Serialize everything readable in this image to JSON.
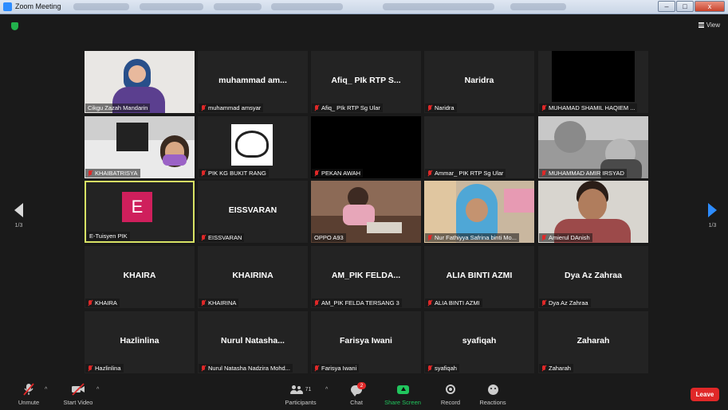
{
  "window": {
    "title": "Zoom Meeting",
    "controls": [
      "–",
      "□",
      "x"
    ]
  },
  "header": {
    "view_label": "View",
    "security_icon": "shield-icon"
  },
  "pagination": {
    "left_label": "1/3",
    "right_label": "1/3"
  },
  "tiles": [
    {
      "name": "Cikgu Zazah Mandarin",
      "center": "",
      "muted": false,
      "video": true
    },
    {
      "name": "muhammad amsyar",
      "center": "muhammad am...",
      "muted": true,
      "video": false
    },
    {
      "name": "Afiq_ PIk RTP Sg Ular",
      "center": "Afiq_ PIk RTP S...",
      "muted": true,
      "video": false
    },
    {
      "name": "Naridra",
      "center": "Naridra",
      "muted": true,
      "video": false
    },
    {
      "name": "MUHAMAD SHAMIL HAQIEM ...",
      "center": "",
      "muted": true,
      "video": true
    },
    {
      "name": "KHAIBATRISYA",
      "center": "",
      "muted": true,
      "video": true
    },
    {
      "name": "PIK KG BUKIT RANG",
      "center": "",
      "muted": true,
      "video": true
    },
    {
      "name": "PEKAN AWAH",
      "center": "",
      "muted": true,
      "video": true
    },
    {
      "name": "Ammar_ PIK RTP Sg Ular",
      "center": "",
      "muted": true,
      "video": true
    },
    {
      "name": "MUHAMMAD AMIR IRSYAD",
      "center": "",
      "muted": true,
      "video": true
    },
    {
      "name": "E-Tuisyen PIK",
      "center": "",
      "muted": false,
      "video": false,
      "avatar_letter": "E",
      "active": true
    },
    {
      "name": "EISSVARAN",
      "center": "EISSVARAN",
      "muted": true,
      "video": false
    },
    {
      "name": "OPPO A93",
      "center": "",
      "muted": false,
      "video": true
    },
    {
      "name": "Nur Fathiyya Safrina binti Mo...",
      "center": "",
      "muted": true,
      "video": true
    },
    {
      "name": "Amierul DAnish",
      "center": "",
      "muted": true,
      "video": true
    },
    {
      "name": "KHAIRA",
      "center": "KHAIRA",
      "muted": true,
      "video": false
    },
    {
      "name": "KHAIRINA",
      "center": "KHAIRINA",
      "muted": true,
      "video": false
    },
    {
      "name": "AM_PIK FELDA TERSANG 3",
      "center": "AM_PIK FELDA...",
      "muted": true,
      "video": false
    },
    {
      "name": "ALIA BINTI AZMI",
      "center": "ALIA BINTI AZMI",
      "muted": true,
      "video": false
    },
    {
      "name": "Dya Az Zahraa",
      "center": "Dya Az Zahraa",
      "muted": true,
      "video": false
    },
    {
      "name": "Hazlinlina",
      "center": "Hazlinlina",
      "muted": true,
      "video": false
    },
    {
      "name": "Nurul Natasha Nadzira Mohd...",
      "center": "Nurul Natasha...",
      "muted": true,
      "video": false
    },
    {
      "name": "Farisya Iwani",
      "center": "Farisya Iwani",
      "muted": true,
      "video": false
    },
    {
      "name": "syafiqah",
      "center": "syafiqah",
      "muted": true,
      "video": false
    },
    {
      "name": "Zaharah",
      "center": "Zaharah",
      "muted": true,
      "video": false
    }
  ],
  "toolbar": {
    "unmute": "Unmute",
    "start_video": "Start Video",
    "participants": "Participants",
    "participants_count": "71",
    "chat": "Chat",
    "chat_badge": "2",
    "share_screen": "Share Screen",
    "record": "Record",
    "reactions": "Reactions",
    "leave": "Leave"
  },
  "colors": {
    "share_green": "#21c55d",
    "leave_red": "#e02828",
    "active_border": "#d7e264",
    "avatar_pink": "#cf1f5c",
    "zoom_blue": "#2d8cff"
  }
}
